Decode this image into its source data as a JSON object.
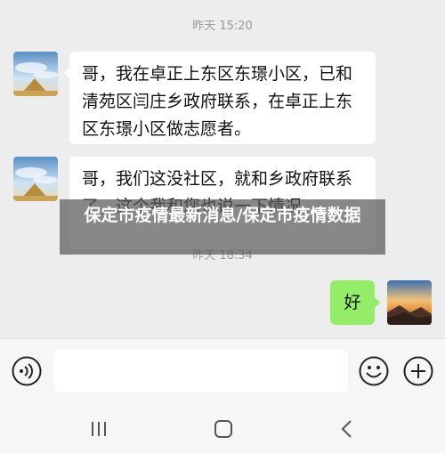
{
  "chat": {
    "timestamp_1": "昨天 15:20",
    "timestamp_2": "昨天 18:34",
    "message_1": "哥，我在卓正上东区东璟小区，已和清苑区闫庄乡政府联系，在卓正上东区东璟小区做志愿者。",
    "message_2": "哥，我们这没社区，就和乡政府联系了，这个我和您也说一下情况",
    "reply_1": "好"
  },
  "overlay": {
    "title": "保定市疫情最新消息/保定市疫情数据"
  },
  "input_bar": {
    "voice_icon": "voice-icon",
    "emoji_icon": "emoji-icon",
    "plus_icon": "plus-icon"
  },
  "nav": {
    "recent_icon": "recent-apps-icon",
    "home_icon": "home-icon",
    "back_icon": "back-icon"
  },
  "colors": {
    "background": "#ededed",
    "incoming_bubble": "#ffffff",
    "outgoing_bubble": "#95ec69"
  }
}
